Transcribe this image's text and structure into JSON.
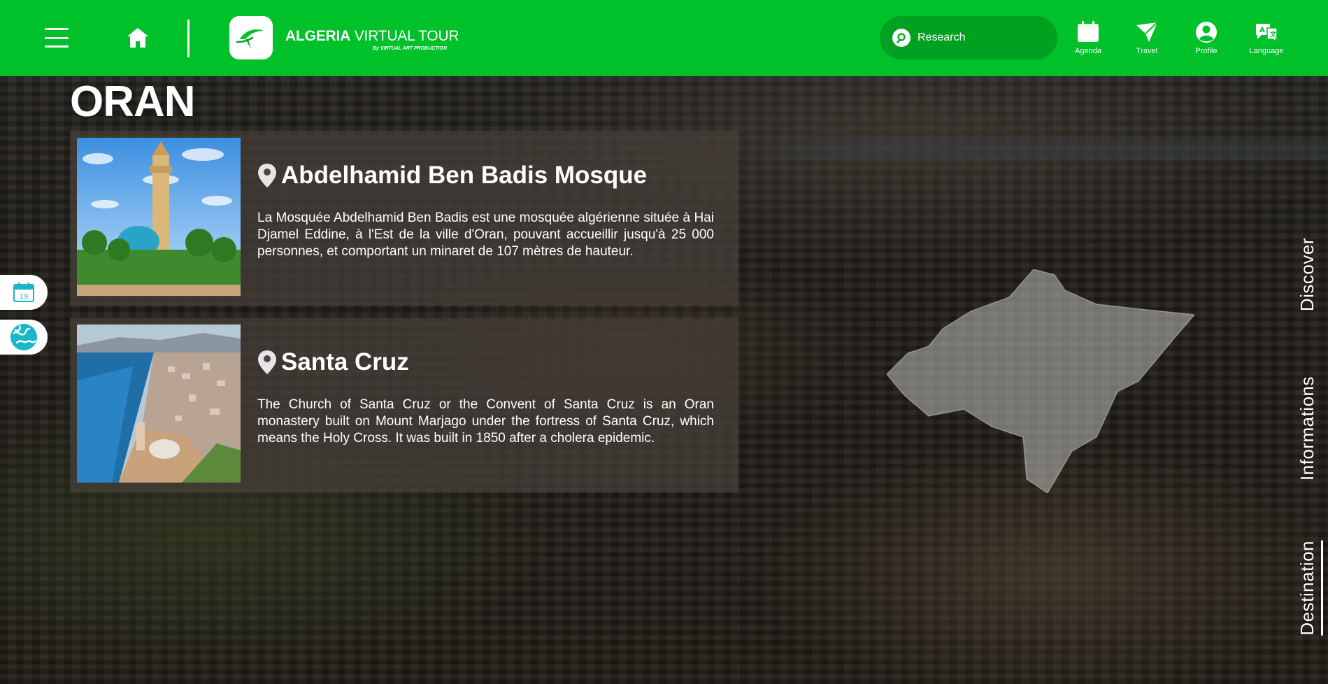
{
  "header": {
    "brand_bold": "ALGERIA",
    "brand_rest": " VIRTUAL TOUR",
    "brand_sub": "By VIRTUAL ART PRODUCTION",
    "search_placeholder": "Research",
    "nav": [
      {
        "label": "Agenda",
        "icon": "calendar-icon"
      },
      {
        "label": "Travel",
        "icon": "paper-plane-icon"
      },
      {
        "label": "Profile",
        "icon": "user-icon"
      },
      {
        "label": "Language",
        "icon": "translate-icon"
      }
    ],
    "accent_color": "#00c12a"
  },
  "page": {
    "city": "ORAN"
  },
  "places": [
    {
      "name": "Abdelhamid Ben Badis Mosque",
      "description": "La Mosquée Abdelhamid Ben Badis est une mosquée algérienne située à Hai Djamel Eddine, à l'Est de la ville d'Oran, pouvant accueillir jusqu'à 25 000 personnes, et comportant un minaret de 107 mètres de hauteur."
    },
    {
      "name": "Santa Cruz",
      "description": "The Church of Santa Cruz or the Convent of Santa Cruz is an Oran monastery built on Mount Marjago under the fortress of Santa Cruz, which means the Holy Cross. It was built in 1850 after a cholera epidemic."
    }
  ],
  "side_buttons": {
    "calendar_day": "19"
  },
  "right_tabs": {
    "discover": "Discover",
    "informations": "Informations",
    "destination": "Destination",
    "active": "Destination"
  }
}
